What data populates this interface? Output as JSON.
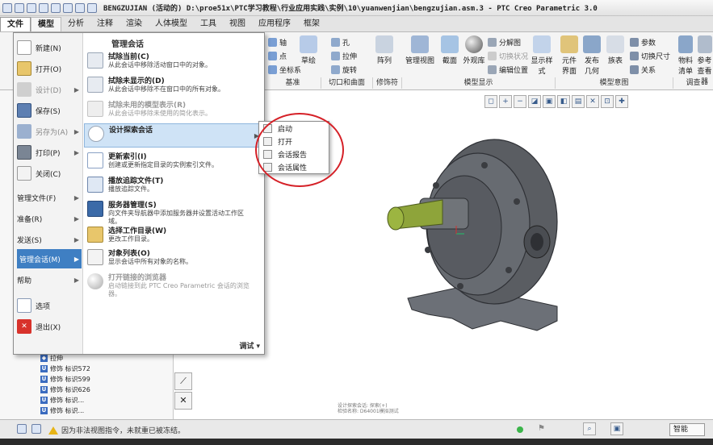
{
  "window": {
    "title": "BENGZUJIAN (活动的) D:\\proe51x\\PTC学习教程\\行业应用实践\\实例\\10\\yuanwenjian\\bengzujian.asm.3 - PTC Creo Parametric 3.0"
  },
  "tabs": [
    {
      "label": "文件"
    },
    {
      "label": "模型"
    },
    {
      "label": "分析"
    },
    {
      "label": "注释"
    },
    {
      "label": "渲染"
    },
    {
      "label": "人体模型"
    },
    {
      "label": "工具"
    },
    {
      "label": "视图"
    },
    {
      "label": "应用程序"
    },
    {
      "label": "框架"
    }
  ],
  "ribbon": {
    "axis": "轴",
    "point": "点",
    "sketch": "草绘",
    "csys": "坐标系",
    "hole": "孔",
    "extrude": "拉伸",
    "revolve": "旋转",
    "pattern": "阵列",
    "manage_view": "管理视图",
    "section": "截面",
    "appearance": "外观库",
    "explode": "分解图",
    "toggle_state": "切换状况",
    "edit_position": "编辑位置",
    "display_style": "显示样式",
    "component_interface": "元件界面",
    "publish_geometry": "发布几何",
    "table": "族表",
    "params": "参数",
    "switch_dims": "切换尺寸",
    "relations": "关系",
    "bom": "物料清单",
    "ref": "参考查看器",
    "groups": {
      "datum": "基准",
      "cut_surface": "切口和曲面",
      "modifiers": "修饰符",
      "model_display": "模型显示",
      "model_intent": "模型意图",
      "investigate": "调查"
    }
  },
  "file_menu": {
    "left_items": [
      {
        "label": "新建(N)",
        "dim": false
      },
      {
        "label": "打开(O)",
        "dim": false
      },
      {
        "label": "设计(D)",
        "dim": true
      },
      {
        "label": "保存(S)",
        "dim": false
      },
      {
        "label": "另存为(A)",
        "dim": true
      },
      {
        "label": "打印(P)",
        "dim": false
      },
      {
        "label": "关闭(C)",
        "dim": false
      },
      {
        "label": "管理文件(F)",
        "dim": false
      },
      {
        "label": "准备(R)",
        "dim": false
      },
      {
        "label": "发送(S)",
        "dim": false
      },
      {
        "label": "管理会话(M)",
        "dim": false
      },
      {
        "label": "帮助",
        "dim": false
      },
      {
        "label": "选项",
        "dim": false
      },
      {
        "label": "退出(X)",
        "dim": false
      }
    ],
    "header": "管理会话",
    "entries": [
      {
        "title": "拭除当前(C)",
        "desc": "从此会话中移除活动窗口中的对象。"
      },
      {
        "title": "拭除未显示的(D)",
        "desc": "从此会话中移除不在窗口中的所有对象。"
      },
      {
        "title": "拭除未用的模型表示(R)",
        "desc": "从此会话中移除未使用的简化表示。"
      },
      {
        "title": "设计探索会话",
        "desc": ""
      },
      {
        "title": "更新索引(I)",
        "desc": "创建或更新指定目录的实例索引文件。"
      },
      {
        "title": "播放追踪文件(T)",
        "desc": "播放追踪文件。"
      },
      {
        "title": "服务器管理(S)",
        "desc": "向文件夹导航器中添加服务器并设置活动工作区域。"
      },
      {
        "title": "选择工作目录(W)",
        "desc": "更改工作目录。"
      },
      {
        "title": "对象列表(O)",
        "desc": "显示会话中所有对象的名称。"
      },
      {
        "title": "打开链接的浏览器",
        "desc": "启动链接到此 PTC Creo Parametric 会话的浏览器。"
      }
    ],
    "bottom": "调试"
  },
  "submenu": {
    "items": [
      "启动",
      "打开",
      "会话报告",
      "会话属性"
    ]
  },
  "tree": {
    "items": [
      {
        "label": "拉伸"
      },
      {
        "label": "修饰 标识572"
      },
      {
        "label": "修饰 标识599"
      },
      {
        "label": "修饰 标识626"
      },
      {
        "label": "修饰 标识..."
      },
      {
        "label": "修饰 标识..."
      }
    ]
  },
  "status": {
    "message": "因为非法视图指令，未就重已被冻结。",
    "smart": "智能"
  },
  "viewport": {
    "note1": "设计探索会话: 探索(+)",
    "note2": "检验名称: D64001模拟测试"
  },
  "colors": {
    "accent": "#3f7fc3",
    "circle": "#d52027",
    "shaft": "#8ea43a",
    "body": "#5a5d62"
  }
}
